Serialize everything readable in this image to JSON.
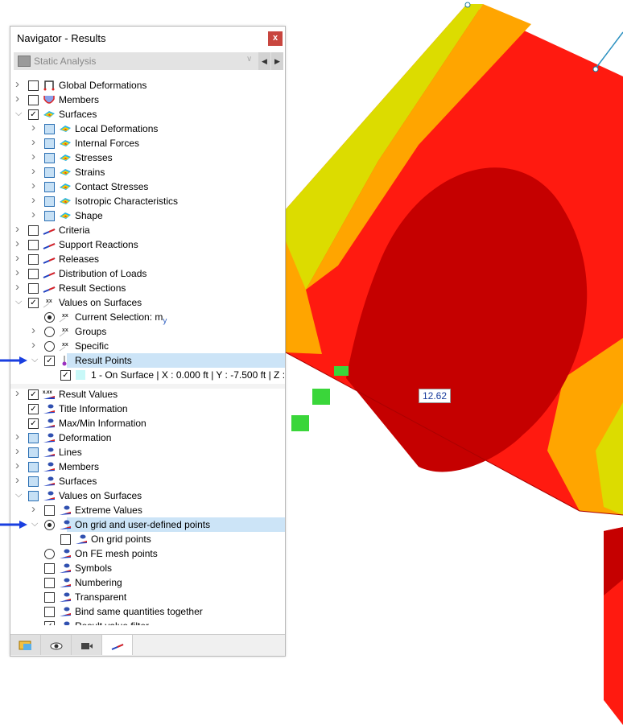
{
  "window": {
    "title": "Navigator - Results",
    "close": "x"
  },
  "combo": {
    "value": "Static Analysis",
    "prev": "◀",
    "next": "▶"
  },
  "rows": [
    {
      "label": "Global Deformations",
      "lvl": 0,
      "exp": ">",
      "check": "cb",
      "state": "off",
      "icon": "global-deformations-icon"
    },
    {
      "label": "Members",
      "lvl": 0,
      "exp": ">",
      "check": "cb",
      "state": "off",
      "icon": "members-icon"
    },
    {
      "label": "Surfaces",
      "lvl": 0,
      "exp": "v",
      "check": "cb",
      "state": "on",
      "icon": "surfaces-icon"
    },
    {
      "label": "Local Deformations",
      "lvl": 1,
      "exp": ">",
      "check": "cb",
      "state": "part",
      "icon": "surfaces-icon"
    },
    {
      "label": "Internal Forces",
      "lvl": 1,
      "exp": ">",
      "check": "cb",
      "state": "part",
      "icon": "surfaces-icon"
    },
    {
      "label": "Stresses",
      "lvl": 1,
      "exp": ">",
      "check": "cb",
      "state": "part",
      "icon": "surfaces-icon"
    },
    {
      "label": "Strains",
      "lvl": 1,
      "exp": ">",
      "check": "cb",
      "state": "part",
      "icon": "surfaces-icon"
    },
    {
      "label": "Contact Stresses",
      "lvl": 1,
      "exp": ">",
      "check": "cb",
      "state": "part",
      "icon": "surfaces-icon"
    },
    {
      "label": "Isotropic Characteristics",
      "lvl": 1,
      "exp": ">",
      "check": "cb",
      "state": "part",
      "icon": "surfaces-icon"
    },
    {
      "label": "Shape",
      "lvl": 1,
      "exp": ">",
      "check": "cb",
      "state": "part",
      "icon": "surfaces-icon"
    },
    {
      "label": "Criteria",
      "lvl": 0,
      "exp": ">",
      "check": "cb",
      "state": "off",
      "icon": "criteria-icon"
    },
    {
      "label": "Support Reactions",
      "lvl": 0,
      "exp": ">",
      "check": "cb",
      "state": "off",
      "icon": "support-reactions-icon"
    },
    {
      "label": "Releases",
      "lvl": 0,
      "exp": ">",
      "check": "cb",
      "state": "off",
      "icon": "releases-icon"
    },
    {
      "label": "Distribution of Loads",
      "lvl": 0,
      "exp": ">",
      "check": "cb",
      "state": "off",
      "icon": "distribution-icon"
    },
    {
      "label": "Result Sections",
      "lvl": 0,
      "exp": ">",
      "check": "cb",
      "state": "off",
      "icon": "result-sections-icon"
    },
    {
      "label": "Values on Surfaces",
      "lvl": 0,
      "exp": "v",
      "check": "cb",
      "state": "on",
      "icon": "values-icon"
    },
    {
      "label": "Current Selection: m",
      "sub": "y",
      "lvl": 1,
      "exp": "",
      "check": "rb",
      "state": "on",
      "icon": "values-icon"
    },
    {
      "label": "Groups",
      "lvl": 1,
      "exp": ">",
      "check": "rb",
      "state": "off",
      "icon": "values-icon"
    },
    {
      "label": "Specific",
      "lvl": 1,
      "exp": ">",
      "check": "rb",
      "state": "off",
      "icon": "values-icon"
    },
    {
      "label": "Result Points",
      "lvl": 1,
      "exp": "v",
      "check": "cb",
      "state": "on",
      "icon": "result-point-icon",
      "selected": true,
      "arrow": true
    },
    {
      "label": "1 - On Surface | X : 0.000 ft | Y : -7.500 ft | Z : ...",
      "lvl": 2,
      "exp": "",
      "check": "cb",
      "state": "on",
      "icon": "color-swatch-icon"
    },
    {
      "sep": true
    },
    {
      "label": "Result Values",
      "lvl": 0,
      "exp": ">",
      "check": "cb",
      "state": "on",
      "icon": "result-values-icon"
    },
    {
      "label": "Title Information",
      "lvl": 0,
      "exp": "",
      "check": "cb",
      "state": "on",
      "icon": "display-icon"
    },
    {
      "label": "Max/Min Information",
      "lvl": 0,
      "exp": "",
      "check": "cb",
      "state": "on",
      "icon": "display-icon"
    },
    {
      "label": "Deformation",
      "lvl": 0,
      "exp": ">",
      "check": "cb",
      "state": "part",
      "icon": "display-icon"
    },
    {
      "label": "Lines",
      "lvl": 0,
      "exp": ">",
      "check": "cb",
      "state": "part",
      "icon": "display-icon"
    },
    {
      "label": "Members",
      "lvl": 0,
      "exp": ">",
      "check": "cb",
      "state": "part",
      "icon": "display-icon"
    },
    {
      "label": "Surfaces",
      "lvl": 0,
      "exp": ">",
      "check": "cb",
      "state": "part",
      "icon": "display-icon"
    },
    {
      "label": "Values on Surfaces",
      "lvl": 0,
      "exp": "v",
      "check": "cb",
      "state": "part",
      "icon": "display-icon"
    },
    {
      "label": "Extreme Values",
      "lvl": 1,
      "exp": ">",
      "check": "cb",
      "state": "off",
      "icon": "display-icon"
    },
    {
      "label": "On grid and user-defined points",
      "lvl": 1,
      "exp": "v",
      "check": "rb",
      "state": "on",
      "icon": "display-icon",
      "selected": true,
      "arrow": true
    },
    {
      "label": "On grid points",
      "lvl": 2,
      "exp": "",
      "check": "cb",
      "state": "off",
      "icon": "display-icon"
    },
    {
      "label": "On FE mesh points",
      "lvl": 1,
      "exp": "",
      "check": "rb",
      "state": "off",
      "icon": "display-icon"
    },
    {
      "label": "Symbols",
      "lvl": 1,
      "exp": "",
      "check": "cb",
      "state": "off",
      "icon": "display-icon"
    },
    {
      "label": "Numbering",
      "lvl": 1,
      "exp": "",
      "check": "cb",
      "state": "off",
      "icon": "display-icon"
    },
    {
      "label": "Transparent",
      "lvl": 1,
      "exp": "",
      "check": "cb",
      "state": "off",
      "icon": "display-icon"
    },
    {
      "label": "Bind same quantities together",
      "lvl": 1,
      "exp": "",
      "check": "cb",
      "state": "off",
      "icon": "display-icon"
    },
    {
      "label": "Result value filter",
      "lvl": 1,
      "exp": "",
      "check": "cb",
      "state": "on",
      "icon": "display-icon"
    }
  ],
  "tabs": [
    {
      "name": "data-tab",
      "icon": "data-icon"
    },
    {
      "name": "view-tab",
      "icon": "eye-icon"
    },
    {
      "name": "camera-tab",
      "icon": "camera-icon"
    },
    {
      "name": "results-tab",
      "icon": "results-icon",
      "active": true
    }
  ],
  "viewport": {
    "value_label": "12.62"
  },
  "colors": {
    "accent_arrow": "#1a3fe0",
    "selection": "#cce4f7",
    "red": "#ff1a10",
    "dark_red": "#c00000",
    "orange": "#ffa500",
    "yellow": "#dcdc00"
  }
}
